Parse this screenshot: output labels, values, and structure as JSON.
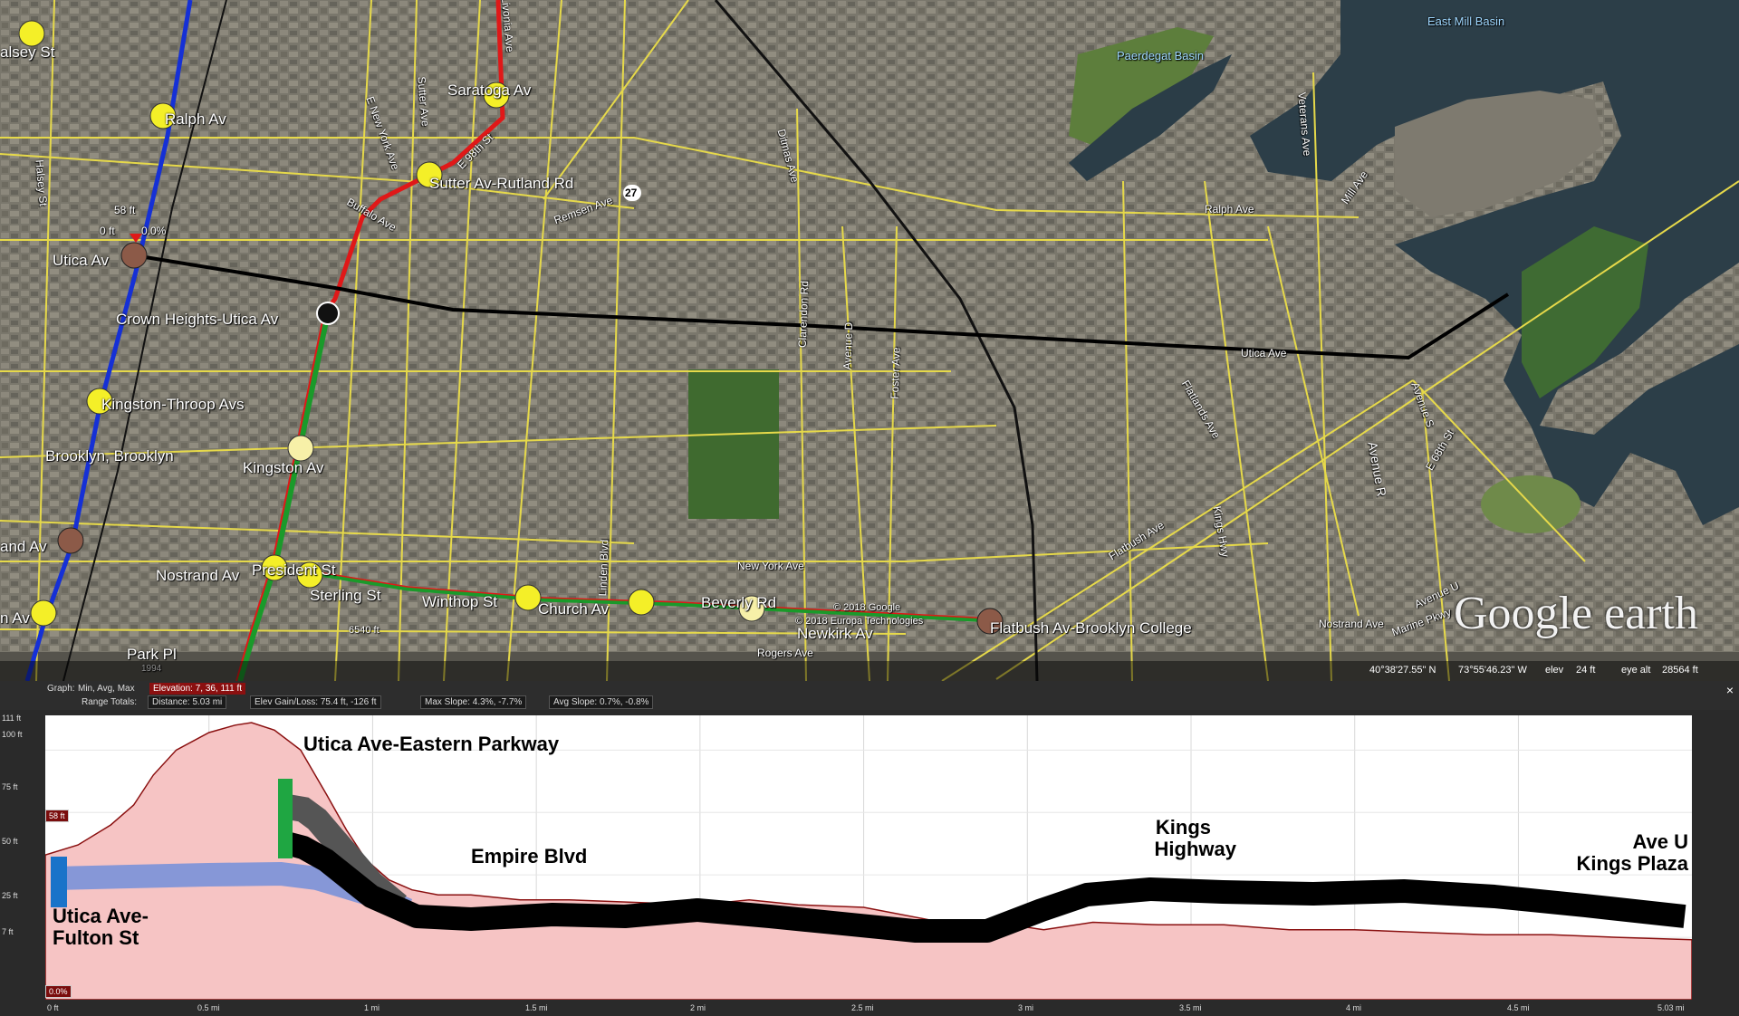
{
  "map": {
    "stations_left": [
      "alsey St",
      "Ralph Av",
      "Utica Av",
      "Crown Heights-Utica Av",
      "Kingston-Throop Avs",
      "Brooklyn, Brooklyn",
      "Kingston Av",
      "and Av",
      "n Av",
      "Nostrand Av",
      "President St",
      "Sterling St",
      "Winthop St",
      "Church Av",
      "Beverly Rd",
      "Flatbush Av-Brooklyn College",
      "Saratoga Av",
      "Sutter Av-Rutland Rd",
      "Park Pl"
    ],
    "streets": [
      "Ralph Ave",
      "Utica Ave",
      "Flatbush Ave",
      "New York Ave",
      "Newkirk Av",
      "Rogers Ave",
      "Nostrand Ave",
      "Marine Pkwy",
      "Remsen Ave",
      "Buffalo Ave",
      "E New York Ave",
      "Sutter Ave",
      "Livonia Ave",
      "E 98th St",
      "Clarendon Rd",
      "Avenue D",
      "Foster Ave",
      "Ditmas Ave",
      "Kings Hwy",
      "Flatlands Ave",
      "Avenue S",
      "Avenue R",
      "E 68th St",
      "Veterans Ave",
      "Mill Ave",
      "Halsey St",
      "Linden Blvd",
      "Avenue U",
      "Paerdegat Basin",
      "East Mill Basin"
    ],
    "route_badge": "27",
    "elev_marker": {
      "label_ft": "58 ft",
      "sub": "0 ft",
      "pct": "0.0%"
    },
    "copyright_1": "© 2018 Google",
    "copyright_2": "© 2018 Europa Technologies",
    "scale_top": "6540 ft",
    "year": "1994",
    "logo": "Google earth",
    "status": {
      "lat": "40°38'27.55\" N",
      "lon": "73°55'46.23\" W",
      "elev_label": "elev",
      "elev": "24 ft",
      "eye_label": "eye alt",
      "eye": "28564 ft"
    }
  },
  "profile": {
    "header": {
      "graph_label": "Graph:",
      "graph_value": "Min, Avg, Max",
      "elevation_value": "Elevation: 7, 36, 111 ft",
      "range_label": "Range Totals:",
      "distance": "Distance: 5.03 mi",
      "elev_gain": "Elev Gain/Loss: 75.4 ft, -126 ft",
      "max_slope": "Max Slope: 4.3%, -7.7%",
      "avg_slope": "Avg Slope: 0.7%, -0.8%",
      "close": "×"
    },
    "y_ticks": [
      "111 ft",
      "100 ft",
      "75 ft",
      "50 ft",
      "25 ft",
      "7 ft"
    ],
    "x_ticks": [
      "0 ft",
      "0.5 mi",
      "1 mi",
      "1.5 mi",
      "2 mi",
      "2.5 mi",
      "3 mi",
      "3.5 mi",
      "4 mi",
      "4.5 mi",
      "5.03 mi"
    ],
    "marker_ft": "58 ft",
    "bottom_pct": "0.0%",
    "station_labels": [
      {
        "id": "utica-fulton",
        "lines": [
          "Utica Ave-",
          "Fulton St"
        ]
      },
      {
        "id": "eastern-parkway",
        "lines": [
          "Utica Ave-Eastern Parkway"
        ]
      },
      {
        "id": "empire",
        "lines": [
          "Empire Blvd"
        ]
      },
      {
        "id": "kings-hwy",
        "lines": [
          "Kings",
          "Highway"
        ]
      },
      {
        "id": "ave-u",
        "lines": [
          "Ave U",
          "Kings Plaza"
        ]
      }
    ],
    "colors": {
      "terrain": "#f6c4c4",
      "terrain_line": "#8a1010",
      "line_black": "#000000",
      "line_blue": "#7f95d8",
      "marker_blue": "#1a73c9",
      "marker_green": "#1fa642"
    }
  },
  "chart_data": {
    "type": "area",
    "title": "",
    "xlabel": "",
    "ylabel": "",
    "x_unit": "mi",
    "y_unit": "ft",
    "xlim": [
      0,
      5.03
    ],
    "ylim": [
      0,
      111
    ],
    "grid": true,
    "series": [
      {
        "x": [
          0,
          0.1,
          0.2,
          0.27,
          0.33,
          0.4,
          0.5,
          0.58,
          0.63,
          0.7,
          0.78,
          0.86,
          0.92,
          0.98,
          1.05,
          1.12,
          1.2,
          1.3,
          1.45,
          1.6,
          1.8,
          2.0,
          2.15,
          2.3,
          2.5,
          2.7,
          2.85,
          2.95,
          3.05,
          3.2,
          3.4,
          3.6,
          3.8,
          4.0,
          4.2,
          4.4,
          4.6,
          4.8,
          5.03
        ],
        "y": [
          58,
          62,
          70,
          78,
          90,
          100,
          107,
          110,
          111,
          108,
          100,
          82,
          68,
          56,
          48,
          44,
          42,
          42,
          40,
          40,
          39,
          38,
          40,
          38,
          37,
          32,
          30,
          30,
          28,
          31,
          30,
          30,
          28,
          28,
          27,
          26,
          26,
          25,
          24
        ]
      }
    ]
  }
}
